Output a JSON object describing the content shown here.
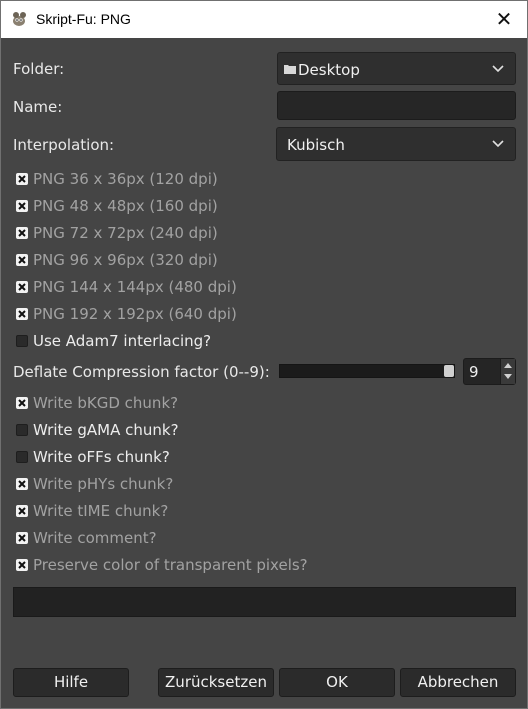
{
  "window": {
    "title": "Skript-Fu: PNG",
    "close_glyph": "✕",
    "app_icon": "gimp-icon"
  },
  "folder": {
    "label": "Folder:",
    "value": "Desktop",
    "icon": "folder-icon"
  },
  "name": {
    "label": "Name:",
    "value": ""
  },
  "interpolation": {
    "label": "Interpolation:",
    "value": "Kubisch"
  },
  "sizes": [
    {
      "label": "PNG 36 x 36px (120 dpi)",
      "checked": true
    },
    {
      "label": "PNG 48 x 48px (160 dpi)",
      "checked": true
    },
    {
      "label": "PNG 72 x 72px (240 dpi)",
      "checked": true
    },
    {
      "label": "PNG 96 x 96px (320 dpi)",
      "checked": true
    },
    {
      "label": "PNG 144 x 144px (480 dpi)",
      "checked": true
    },
    {
      "label": "PNG 192 x 192px (640 dpi)",
      "checked": true
    }
  ],
  "interlace": {
    "label": "Use Adam7 interlacing?",
    "checked": false
  },
  "compression": {
    "label": "Deflate Compression factor (0--9):",
    "value": "9",
    "min": 0,
    "max": 9
  },
  "chunks": [
    {
      "label": "Write bKGD chunk?",
      "checked": true
    },
    {
      "label": "Write gAMA chunk?",
      "checked": false
    },
    {
      "label": "Write oFFs chunk?",
      "checked": false
    },
    {
      "label": "Write pHYs chunk?",
      "checked": true
    },
    {
      "label": "Write tIME chunk?",
      "checked": true
    },
    {
      "label": "Write comment?",
      "checked": true
    },
    {
      "label": "Preserve color of transparent pixels?",
      "checked": true
    }
  ],
  "buttons": {
    "help": "Hilfe",
    "reset": "Zurücksetzen",
    "ok": "OK",
    "cancel": "Abbrechen"
  }
}
